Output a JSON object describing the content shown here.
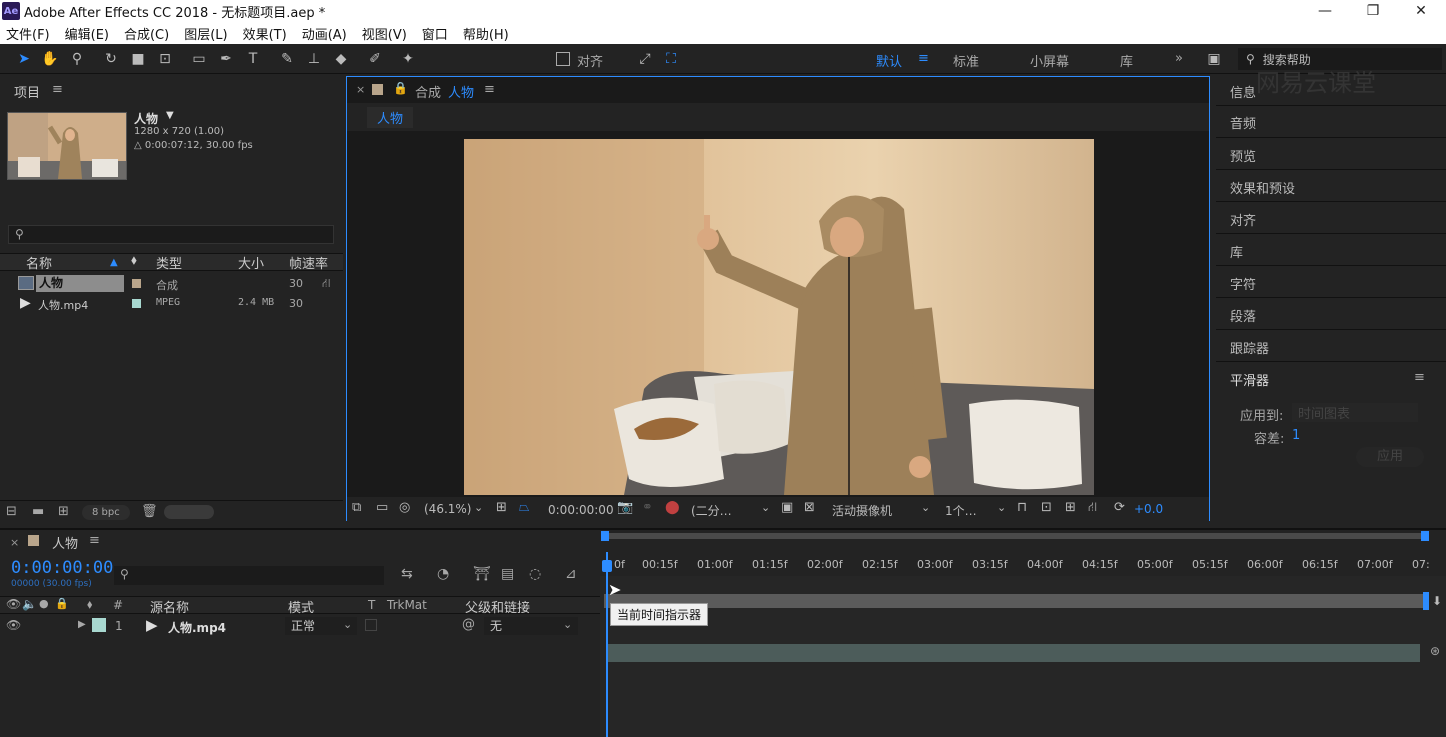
{
  "window": {
    "logo": "Ae",
    "title": "Adobe After Effects CC 2018 - 无标题项目.aep *",
    "min": "—",
    "max": "❐",
    "close": "✕"
  },
  "menu": [
    "文件(F)",
    "编辑(E)",
    "合成(C)",
    "图层(L)",
    "效果(T)",
    "动画(A)",
    "视图(V)",
    "窗口",
    "帮助(H)"
  ],
  "toolbar": {
    "align_label": "对齐",
    "workspaces": [
      "默认",
      "标准",
      "小屏幕",
      "库"
    ],
    "more": "»",
    "search_placeholder": "搜索帮助",
    "active_color": "#2d8cff"
  },
  "project": {
    "title": "项目",
    "item_name": "人物",
    "item_size": "1280 x 720 (1.00)",
    "item_duration": "△ 0:00:07:12, 30.00 fps",
    "columns": [
      "名称",
      "类型",
      "大小",
      "帧速率"
    ],
    "rows": [
      {
        "name": "人物",
        "type": "合成",
        "size": "",
        "fps": "30"
      },
      {
        "name": "人物.mp4",
        "type": "MPEG",
        "size": "2.4 MB",
        "fps": "30"
      }
    ],
    "bpc": "8 bpc"
  },
  "composition": {
    "tab_prefix": "合成",
    "tab_name": "人物",
    "flow_name": "人物",
    "zoom": "(46.1%)",
    "timecode": "0:00:00:00",
    "resolution": "(二分…",
    "camera": "活动摄像机",
    "views": "1个…",
    "exposure": "+0.0"
  },
  "right_panel": {
    "items": [
      "信息",
      "音频",
      "预览",
      "效果和预设",
      "对齐",
      "库",
      "字符",
      "段落",
      "跟踪器"
    ],
    "smoother_title": "平滑器",
    "apply_to_label": "应用到:",
    "apply_to_value": "时间图表",
    "tolerance_label": "容差:",
    "tolerance_value": "1",
    "apply_button": "应用",
    "watermark": "网易云课堂"
  },
  "timeline": {
    "comp_name": "人物",
    "timecode": "0:00:00:00",
    "frames": "00000 (30.00 fps)",
    "columns": [
      "#",
      "源名称",
      "模式",
      "T",
      "TrkMat",
      "父级和链接"
    ],
    "layer": {
      "index": "1",
      "name": "人物.mp4",
      "mode": "正常",
      "parent": "无"
    },
    "ticks": [
      "0f",
      "00:15f",
      "01:00f",
      "01:15f",
      "02:00f",
      "02:15f",
      "03:00f",
      "03:15f",
      "04:00f",
      "04:15f",
      "05:00f",
      "05:15f",
      "06:00f",
      "06:15f",
      "07:00f",
      "07:"
    ],
    "tooltip": "当前时间指示器",
    "accent": "#2d8cff"
  }
}
